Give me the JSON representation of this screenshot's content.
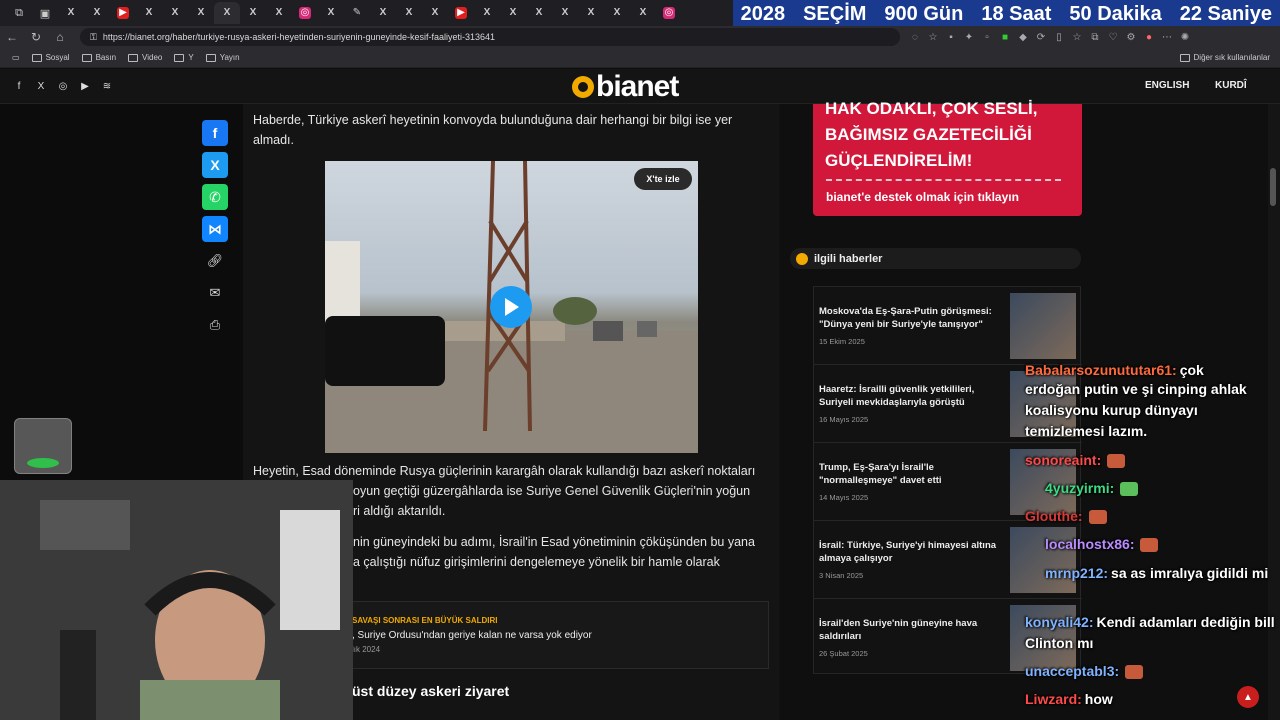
{
  "countdown": {
    "year": "2028",
    "label": "SEÇİM",
    "days": "900 Gün",
    "hours": "18 Saat",
    "minutes": "50 Dakika",
    "seconds": "22 Saniye"
  },
  "browser": {
    "url": "https://bianet.org/haber/turkiye-rusya-askeri-heyetinden-suriyenin-guneyinde-kesif-faaliyeti-313641",
    "bookmarks": [
      "Sosyal",
      "Basın",
      "Video",
      "Y",
      "Yayın"
    ],
    "other_bookmarks": "Diğer sık kullanılanlar"
  },
  "site": {
    "logo": "bianet",
    "lang_english": "ENGLISH",
    "lang_kurdi": "KURDÎ"
  },
  "article": {
    "para1": "Haberde, Türkiye askerî heyetinin konvoyda bulunduğuna dair herhangi bir bilgi ise yer almadı.",
    "watch_on_x": "X'te izle",
    "para2_l1": "Heyetin, Esad döneminde Rusya güçlerinin karargâh olarak kullandığı bazı askerî noktaları",
    "para2_l2": "oyun geçtiği güzergâhlarda ise Suriye Genel Güvenlik Güçleri'nin yoğun",
    "para2_l3": "ri aldığı aktarıldı.",
    "para3_l1": "nin güneyindeki bu adımı, İsrail'in Esad yönetiminin çöküşünden bu yana",
    "para3_l2": "a çalıştığı nüfuz girişimlerini dengelemeye yönelik bir hamle olarak",
    "related_kicker": "SAVAŞI SONRASI EN BÜYÜK SALDIRI",
    "related_title": ", Suriye Ordusu'ndan geriye kalan ne varsa yok ediyor",
    "related_date": "lık 2024",
    "subheading": "'a üst düzey askeri ziyaret"
  },
  "promo": {
    "line1": "HAK ODAKLI, ÇOK SESLİ,",
    "line2": "BAĞIMSIZ GAZETECİLİĞİ",
    "line3": "GÜÇLENDİRELİM!",
    "cta": "bianet'e destek olmak için tıklayın"
  },
  "related": {
    "heading": "ilgili haberler",
    "items": [
      {
        "title": "Moskova'da Eş-Şara-Putin görüşmesi: \"Dünya yeni bir Suriye'yle tanışıyor\"",
        "date": "15 Ekim 2025"
      },
      {
        "title": "Haaretz: İsrailli güvenlik yetkilileri, Suriyeli mevkidaşlarıyla görüştü",
        "date": "16 Mayıs 2025"
      },
      {
        "title": "Trump, Eş-Şara'yı İsrail'le \"normalleşmeye\" davet etti",
        "date": "14 Mayıs 2025"
      },
      {
        "title": "İsrail: Türkiye, Suriye'yi himayesi altına almaya çalışıyor",
        "date": "3 Nisan 2025"
      },
      {
        "title": "İsrail'den Suriye'nin güneyine hava saldırıları",
        "date": "26 Şubat 2025"
      }
    ]
  },
  "chat": [
    {
      "user": "Babalarsozunututar61:",
      "text": "çok",
      "color": "#ff6a3d"
    },
    {
      "user": "",
      "text": "erdoğan putin ve şi cinping ahlak koalisyonu kurup dünyayı temizlemesi lazım.",
      "color": "#ffffff"
    },
    {
      "user": "sonoreaint:",
      "text": "",
      "color": "#ff4a4a"
    },
    {
      "user": "4yuzyirmi:",
      "text": "",
      "color": "#3ddc84"
    },
    {
      "user": "Glouthe:",
      "text": "",
      "color": "#d83a3a"
    },
    {
      "user": "localhostx86:",
      "text": "",
      "color": "#b98cff"
    },
    {
      "user": "mrnp212:",
      "text": "sa as imralıya gidildi mi",
      "color": "#7fb3ff"
    },
    {
      "user": "konyali42:",
      "text": "Kendi adamları dediğin bill Clinton mı",
      "color": "#7fb3ff"
    },
    {
      "user": "unacceptabl3:",
      "text": "",
      "color": "#7fb3ff"
    },
    {
      "user": "Liwzard:",
      "text": "how",
      "color": "#ff4a4a"
    }
  ]
}
